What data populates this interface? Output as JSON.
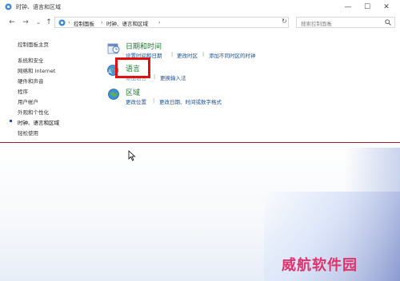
{
  "window": {
    "title": "时钟、语言和区域"
  },
  "nav": {
    "breadcrumbs": [
      "控制面板",
      "时钟、语言和区域"
    ],
    "search_placeholder": "搜索控制面板"
  },
  "sidebar": {
    "items": [
      {
        "label": "控制面板主页"
      },
      {
        "label": "系统和安全"
      },
      {
        "label": "网络和 Internet"
      },
      {
        "label": "硬件和声音"
      },
      {
        "label": "程序"
      },
      {
        "label": "用户帐户"
      },
      {
        "label": "外观和个性化"
      },
      {
        "label": "时钟、语言和区域",
        "active": true
      },
      {
        "label": "轻松使用"
      }
    ]
  },
  "categories": {
    "datetime": {
      "title": "日期和时间",
      "links": [
        "设置时间和日期",
        "更改时区",
        "添加不同时区的时钟"
      ]
    },
    "language": {
      "title": "语言",
      "links": [
        "添加语言",
        "更换输入法"
      ]
    },
    "region": {
      "title": "区域",
      "links": [
        "更改位置",
        "更改日期、时间或数字格式"
      ]
    }
  },
  "watermark": "威航软件园",
  "colors": {
    "category_title": "#1e7a2e",
    "link": "#1a4f9c",
    "highlight_border": "#e01010",
    "watermark": "#e0336b"
  }
}
